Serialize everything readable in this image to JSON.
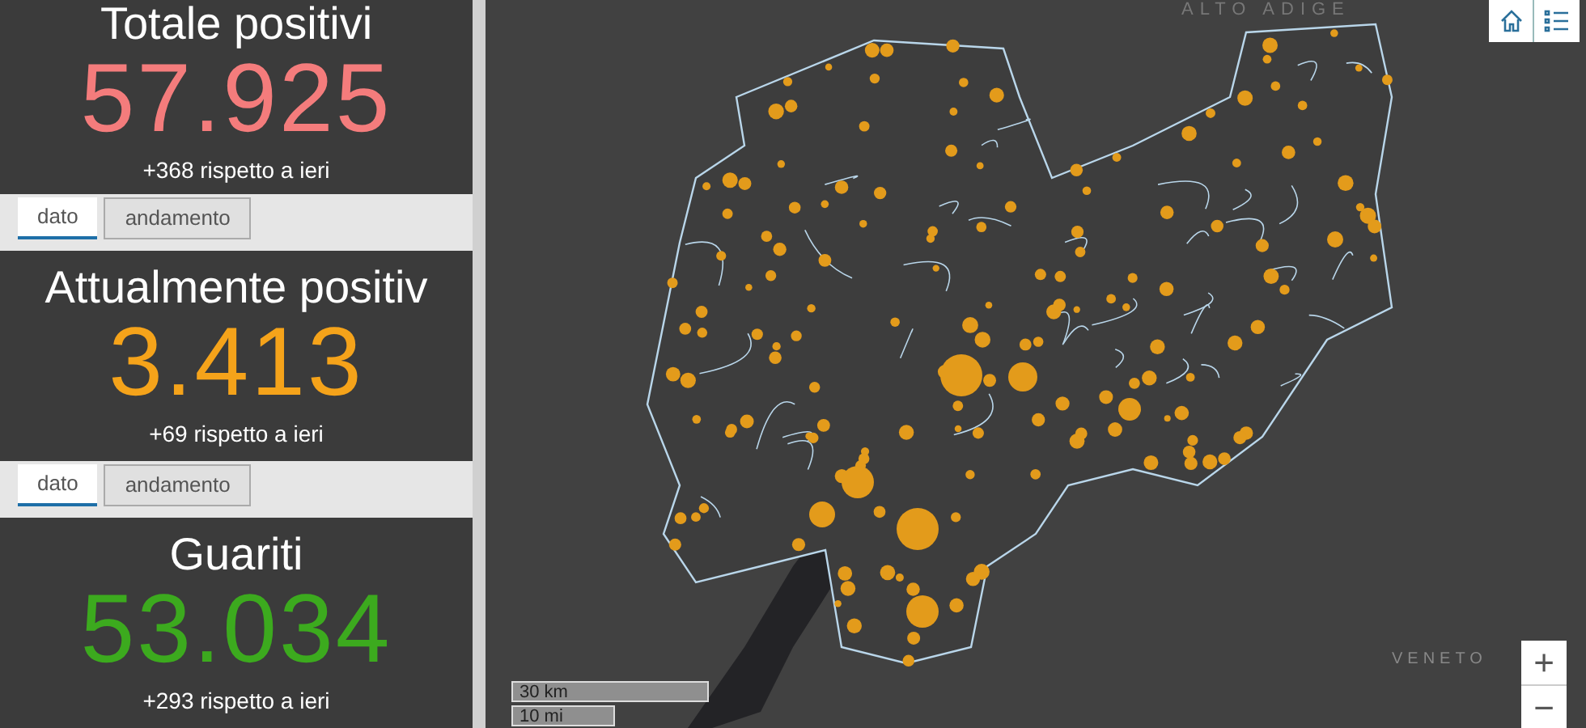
{
  "cards": [
    {
      "title": "Totale positivi",
      "value": "57.925",
      "delta": "+368 rispetto a ieri",
      "color": "#f47c7c",
      "tabs": [
        {
          "label": "dato",
          "selected": true
        },
        {
          "label": "andamento",
          "selected": false
        }
      ]
    },
    {
      "title": "Attualmente positiv",
      "value": "3.413",
      "delta": "+69 rispetto a ieri",
      "color": "#f5a31a",
      "tabs": [
        {
          "label": "dato",
          "selected": true
        },
        {
          "label": "andamento",
          "selected": false
        }
      ]
    },
    {
      "title": "Guariti",
      "value": "53.034",
      "delta": "+293 rispetto a ieri",
      "color": "#3caa1e"
    }
  ],
  "map": {
    "region_labels": [
      "ALTO ADIGE",
      "VENETO"
    ],
    "scale": [
      "30 km",
      "10 mi"
    ],
    "zoom_in": "+",
    "zoom_out": "−"
  }
}
